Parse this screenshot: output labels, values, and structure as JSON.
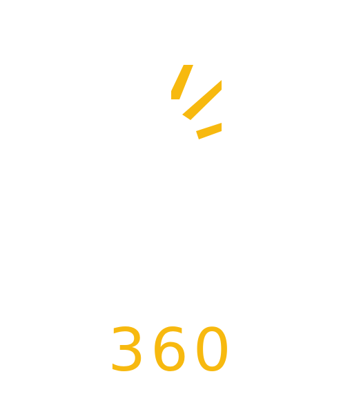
{
  "logo": {
    "wordmark": "360",
    "icon": "sunburst-rays-icon",
    "colors": {
      "accent": "#F7B90F",
      "background": "#FFFFFF"
    }
  }
}
